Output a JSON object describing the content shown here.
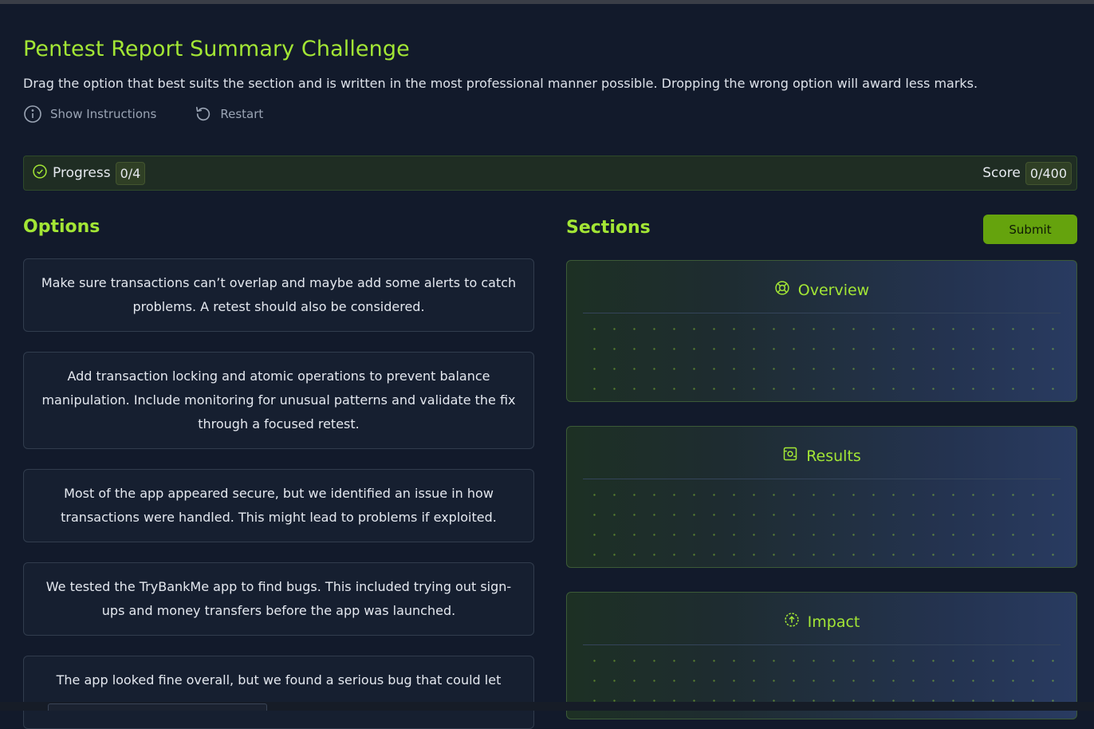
{
  "header": {
    "title": "Pentest Report Summary Challenge",
    "subtitle": "Drag the option that best suits the section and is written in the most professional manner possible. Dropping the wrong option will award less marks.",
    "show_instructions_label": "Show Instructions",
    "restart_label": "Restart"
  },
  "progress": {
    "label": "Progress",
    "value": "0/4",
    "score_label": "Score",
    "score_value": "0/400"
  },
  "options": {
    "title": "Options",
    "items": [
      "Make sure transactions can’t overlap and maybe add some alerts to catch problems. A retest should also be considered.",
      "Add transaction locking and atomic operations to prevent balance manipulation. Include monitoring for unusual patterns and validate the fix through a focused retest.",
      "Most of the app appeared secure, but we identified an issue in how transactions were handled. This might lead to problems if exploited.",
      "We tested the TryBankMe app to find bugs. This included trying out sign-ups and money transfers before the app was launched.",
      "The app looked fine overall, but we found a serious bug that could let"
    ]
  },
  "sections": {
    "title": "Sections",
    "submit_label": "Submit",
    "items": [
      {
        "label": "Overview",
        "icon": "lifebuoy-icon"
      },
      {
        "label": "Results",
        "icon": "scan-icon"
      },
      {
        "label": "Impact",
        "icon": "arrow-up-circle-icon"
      }
    ]
  },
  "colors": {
    "accent": "#a3e635",
    "submit": "#65a30d",
    "background": "#121a2b"
  }
}
